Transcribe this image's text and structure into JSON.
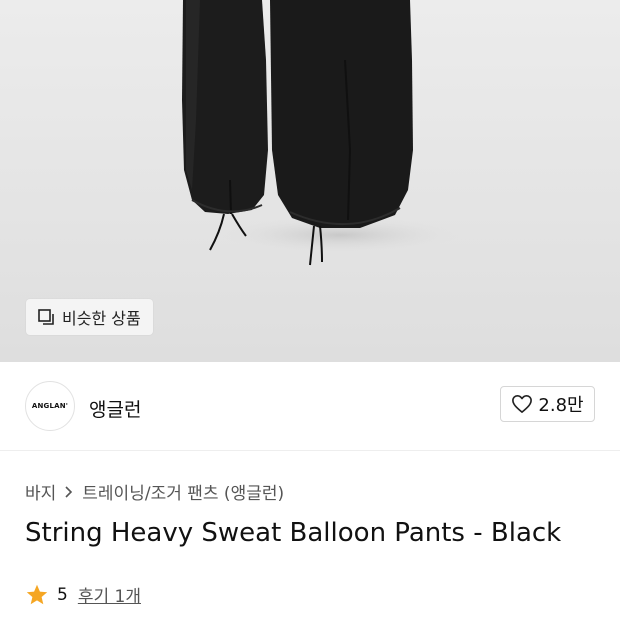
{
  "hero": {
    "similar_button_label": "비슷한 상품"
  },
  "brand": {
    "logo_text": "ANGLAN'",
    "name": "앵글런",
    "like_count": "2.8만"
  },
  "breadcrumb": {
    "items": [
      "바지",
      "트레이닝/조거 팬츠 (앵글런)"
    ]
  },
  "product": {
    "title": "String Heavy Sweat Balloon Pants - Black"
  },
  "rating": {
    "score": "5",
    "reviews_label": "후기 1개"
  },
  "colors": {
    "star": "#F5A623",
    "text": "#111111",
    "muted": "#555555"
  }
}
